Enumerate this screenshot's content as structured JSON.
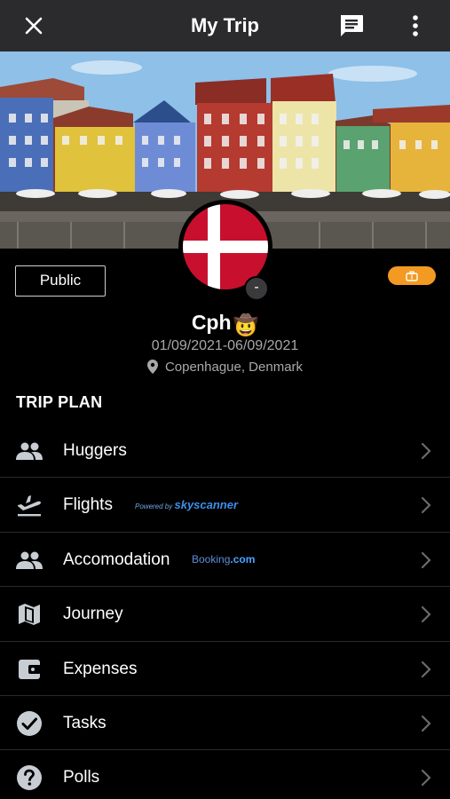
{
  "header": {
    "title": "My Trip",
    "close_icon": "close-icon",
    "chat_icon": "chat-icon",
    "more_icon": "more-vertical-icon"
  },
  "cover": {
    "image": "cover-photo"
  },
  "trip": {
    "visibility_label": "Public",
    "name": "Cph",
    "name_emoji": "🤠",
    "dates": "01/09/2021-06/09/2021",
    "location": "Copenhague, Denmark",
    "avatar_minus": "-"
  },
  "section_title": "TRIP PLAN",
  "plan_items": [
    {
      "label": "Huggers",
      "icon": "group-icon"
    },
    {
      "label": "Flights",
      "icon": "flight-takeoff-icon",
      "partner_prefix": "Powered by",
      "partner_name": "skyscanner"
    },
    {
      "label": "Accomodation",
      "icon": "group-icon",
      "partner_prefix": "Booking",
      "partner_name": ".com"
    },
    {
      "label": "Journey",
      "icon": "map-icon"
    },
    {
      "label": "Expenses",
      "icon": "wallet-icon"
    },
    {
      "label": "Tasks",
      "icon": "check-circle-icon"
    },
    {
      "label": "Polls",
      "icon": "help-circle-icon"
    }
  ],
  "colors": {
    "header_bg": "#2b2b2d",
    "accent_orange": "#f39a22",
    "denmark_red": "#c8102e",
    "icon_grey": "#c8cdd3"
  }
}
